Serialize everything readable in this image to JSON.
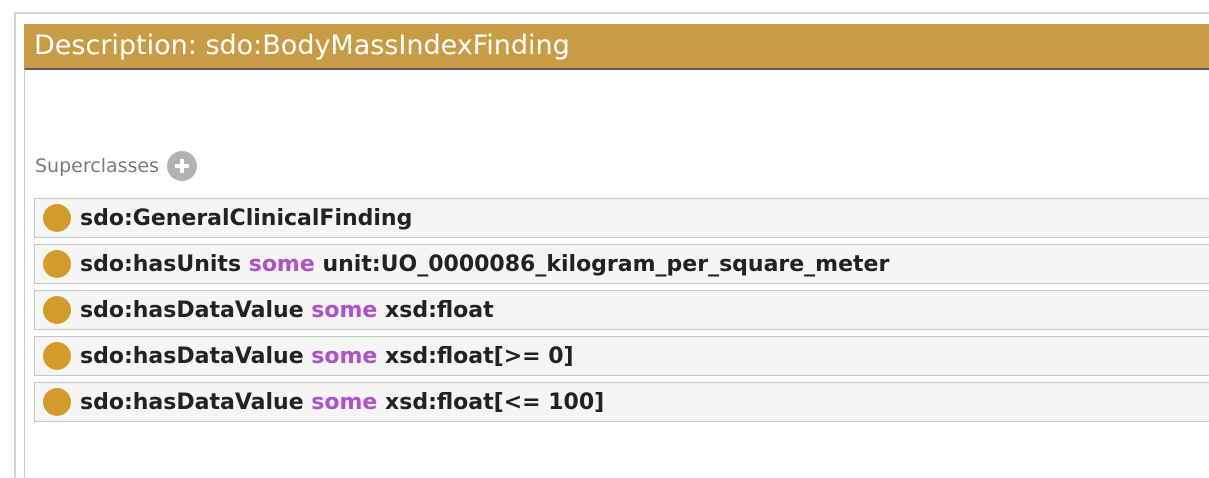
{
  "title": "Description: sdo:BodyMassIndexFinding",
  "section": {
    "label": "Superclasses"
  },
  "rows": [
    {
      "subject": "sdo:GeneralClinicalFinding",
      "keyword": "",
      "object": ""
    },
    {
      "subject": "sdo:hasUnits",
      "keyword": "some",
      "object": "unit:UO_0000086_kilogram_per_square_meter"
    },
    {
      "subject": "sdo:hasDataValue",
      "keyword": "some",
      "object": "xsd:float"
    },
    {
      "subject": "sdo:hasDataValue",
      "keyword": "some",
      "object": "xsd:float[>= 0]"
    },
    {
      "subject": "sdo:hasDataValue",
      "keyword": "some",
      "object": "xsd:float[<= 100]"
    }
  ],
  "colors": {
    "titlebar": "#c89b45",
    "bullet": "#d39b2c",
    "keyword": "#b051c9"
  }
}
